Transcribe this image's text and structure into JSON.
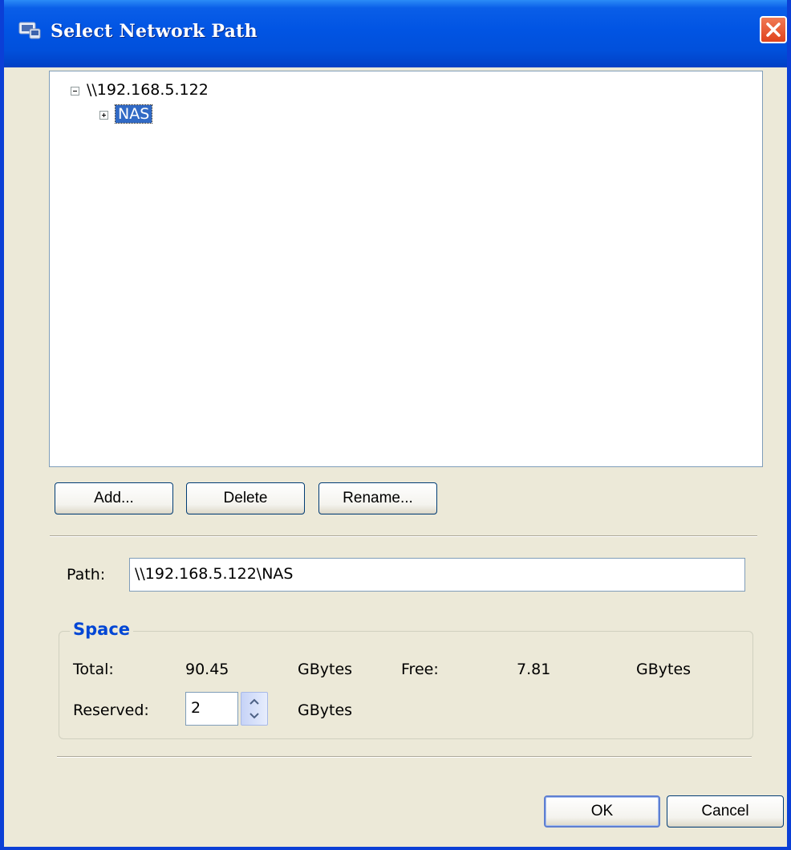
{
  "window": {
    "title": "Select Network Path"
  },
  "tree": {
    "root_label": "\\\\192.168.5.122",
    "child_label": "NAS"
  },
  "buttons": {
    "add": "Add...",
    "delete": "Delete",
    "rename": "Rename...",
    "ok": "OK",
    "cancel": "Cancel"
  },
  "path": {
    "label": "Path:",
    "value": "\\\\192.168.5.122\\NAS"
  },
  "space": {
    "title": "Space",
    "total_label": "Total:",
    "total_value": "90.45",
    "total_unit": "GBytes",
    "free_label": "Free:",
    "free_value": "7.81",
    "free_unit": "GBytes",
    "reserved_label": "Reserved:",
    "reserved_value": "2",
    "reserved_unit": "GBytes"
  },
  "colors": {
    "titlebar": "#0154e3",
    "dialog_bg": "#ece9d8",
    "selection": "#316ac5",
    "group_title": "#0046d5"
  }
}
